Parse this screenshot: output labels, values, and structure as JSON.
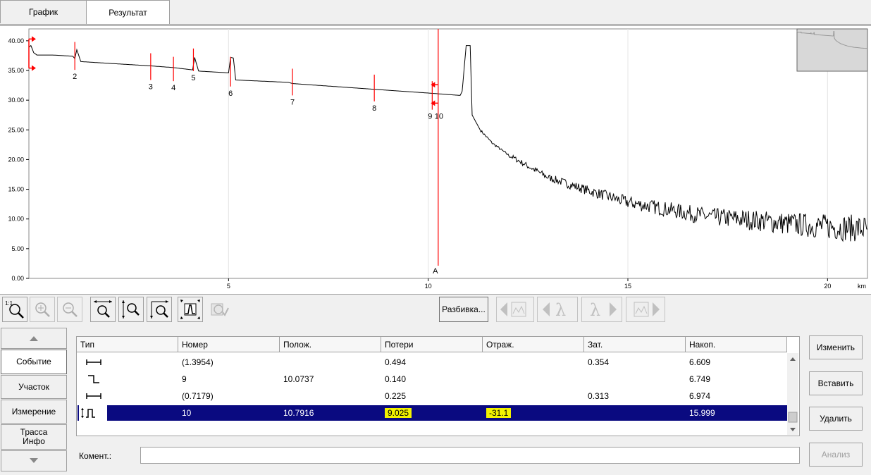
{
  "tabs": [
    {
      "label": "График"
    },
    {
      "label": "Результат"
    }
  ],
  "chart_data": {
    "type": "line",
    "xlabel": "",
    "x_unit": "km",
    "xlim": [
      0,
      21
    ],
    "ylim": [
      0,
      42
    ],
    "x_ticks": [
      {
        "v": 5,
        "label": "5"
      },
      {
        "v": 10,
        "label": "10"
      },
      {
        "v": 15,
        "label": "15"
      },
      {
        "v": 20,
        "label": "20"
      }
    ],
    "y_ticks": [
      {
        "v": 0,
        "label": "0.00"
      },
      {
        "v": 5,
        "label": "5.00"
      },
      {
        "v": 10,
        "label": "10.00"
      },
      {
        "v": 15,
        "label": "15.00"
      },
      {
        "v": 20,
        "label": "20.00"
      },
      {
        "v": 25,
        "label": "25.00"
      },
      {
        "v": 30,
        "label": "30.00"
      },
      {
        "v": 35,
        "label": "35.00"
      },
      {
        "v": 40,
        "label": "40.00"
      }
    ],
    "trace": [
      [
        0.0,
        38.9
      ],
      [
        0.05,
        39.2
      ],
      [
        0.12,
        38.0
      ],
      [
        0.2,
        37.6
      ],
      [
        0.6,
        37.6
      ],
      [
        1.1,
        37.4
      ],
      [
        1.15,
        37.0
      ],
      [
        1.2,
        38.5
      ],
      [
        1.3,
        36.5
      ],
      [
        2.0,
        36.2
      ],
      [
        3.0,
        35.8
      ],
      [
        3.6,
        35.5
      ],
      [
        4.1,
        35.1
      ],
      [
        4.15,
        37.2
      ],
      [
        4.25,
        34.9
      ],
      [
        5.0,
        34.6
      ],
      [
        5.05,
        37.2
      ],
      [
        5.12,
        37.1
      ],
      [
        5.18,
        33.4
      ],
      [
        6.5,
        33.0
      ],
      [
        6.6,
        32.8
      ],
      [
        8.5,
        31.9
      ],
      [
        10.0,
        31.2
      ],
      [
        10.8,
        30.8
      ],
      [
        10.85,
        31.5
      ],
      [
        10.95,
        39.2
      ],
      [
        11.05,
        39.2
      ],
      [
        11.1,
        27.5
      ],
      [
        11.3,
        25.0
      ],
      [
        11.6,
        22.8
      ],
      [
        12.0,
        20.8
      ],
      [
        13.0,
        17.0
      ],
      [
        14.0,
        14.8
      ],
      [
        15.0,
        12.8
      ],
      [
        16.0,
        11.6
      ],
      [
        17.0,
        10.4
      ],
      [
        18.0,
        9.9
      ],
      [
        19.0,
        9.2
      ],
      [
        20.0,
        8.7
      ],
      [
        21.0,
        8.3
      ]
    ],
    "noise_start_km": 12.0,
    "events": [
      {
        "label": "2",
        "x": 1.15,
        "y1": 39.8,
        "y2": 35.1
      },
      {
        "label": "3",
        "x": 3.05,
        "y1": 37.9,
        "y2": 33.4
      },
      {
        "label": "4",
        "x": 3.62,
        "y1": 37.3,
        "y2": 33.2
      },
      {
        "label": "5",
        "x": 4.12,
        "y1": 38.7,
        "y2": 34.9
      },
      {
        "label": "6",
        "x": 5.05,
        "y1": 37.3,
        "y2": 32.3
      },
      {
        "label": "7",
        "x": 6.6,
        "y1": 35.3,
        "y2": 30.8
      },
      {
        "label": "8",
        "x": 8.65,
        "y1": 34.3,
        "y2": 29.8
      },
      {
        "label": "9",
        "x": 10.1,
        "y1": 33.2,
        "y2": 28.4
      },
      {
        "label": "10",
        "x": 10.25,
        "y1": 0,
        "y2": 0
      }
    ],
    "cursor": {
      "label": "A",
      "x": 10.25
    },
    "accent": "#ff0000"
  },
  "toolbar": {
    "split_label": "Разбивка..."
  },
  "nav": {
    "items": [
      {
        "label": "Событие"
      },
      {
        "label": "Участок"
      },
      {
        "label": "Измерение"
      },
      {
        "label": "Трасса Инфо"
      }
    ]
  },
  "table": {
    "columns": [
      "Тип",
      "Номер",
      "Полож.",
      "Потери",
      "Отраж.",
      "Зат.",
      "Накоп."
    ],
    "rows": [
      {
        "type_icon": "segment-icon",
        "number": "(1.3954)",
        "position": "",
        "loss": "0.494",
        "refl": "",
        "atten": "0.354",
        "cum": "6.609"
      },
      {
        "type_icon": "step-down-icon",
        "number": "9",
        "position": "10.0737",
        "loss": "0.140",
        "refl": "",
        "atten": "",
        "cum": "6.749"
      },
      {
        "type_icon": "segment-icon",
        "number": "(0.7179)",
        "position": "",
        "loss": "0.225",
        "refl": "",
        "atten": "0.313",
        "cum": "6.974"
      },
      {
        "type_icon": "end-reflection-icon",
        "number": "10",
        "position": "10.7916",
        "loss": "9.025",
        "refl": "-31.1",
        "atten": "",
        "cum": "15.999"
      }
    ]
  },
  "buttons": {
    "edit": "Изменить",
    "insert": "Вставить",
    "delete": "Удалить",
    "analysis": "Анализ"
  },
  "comment": {
    "label": "Комент.:",
    "value": ""
  }
}
